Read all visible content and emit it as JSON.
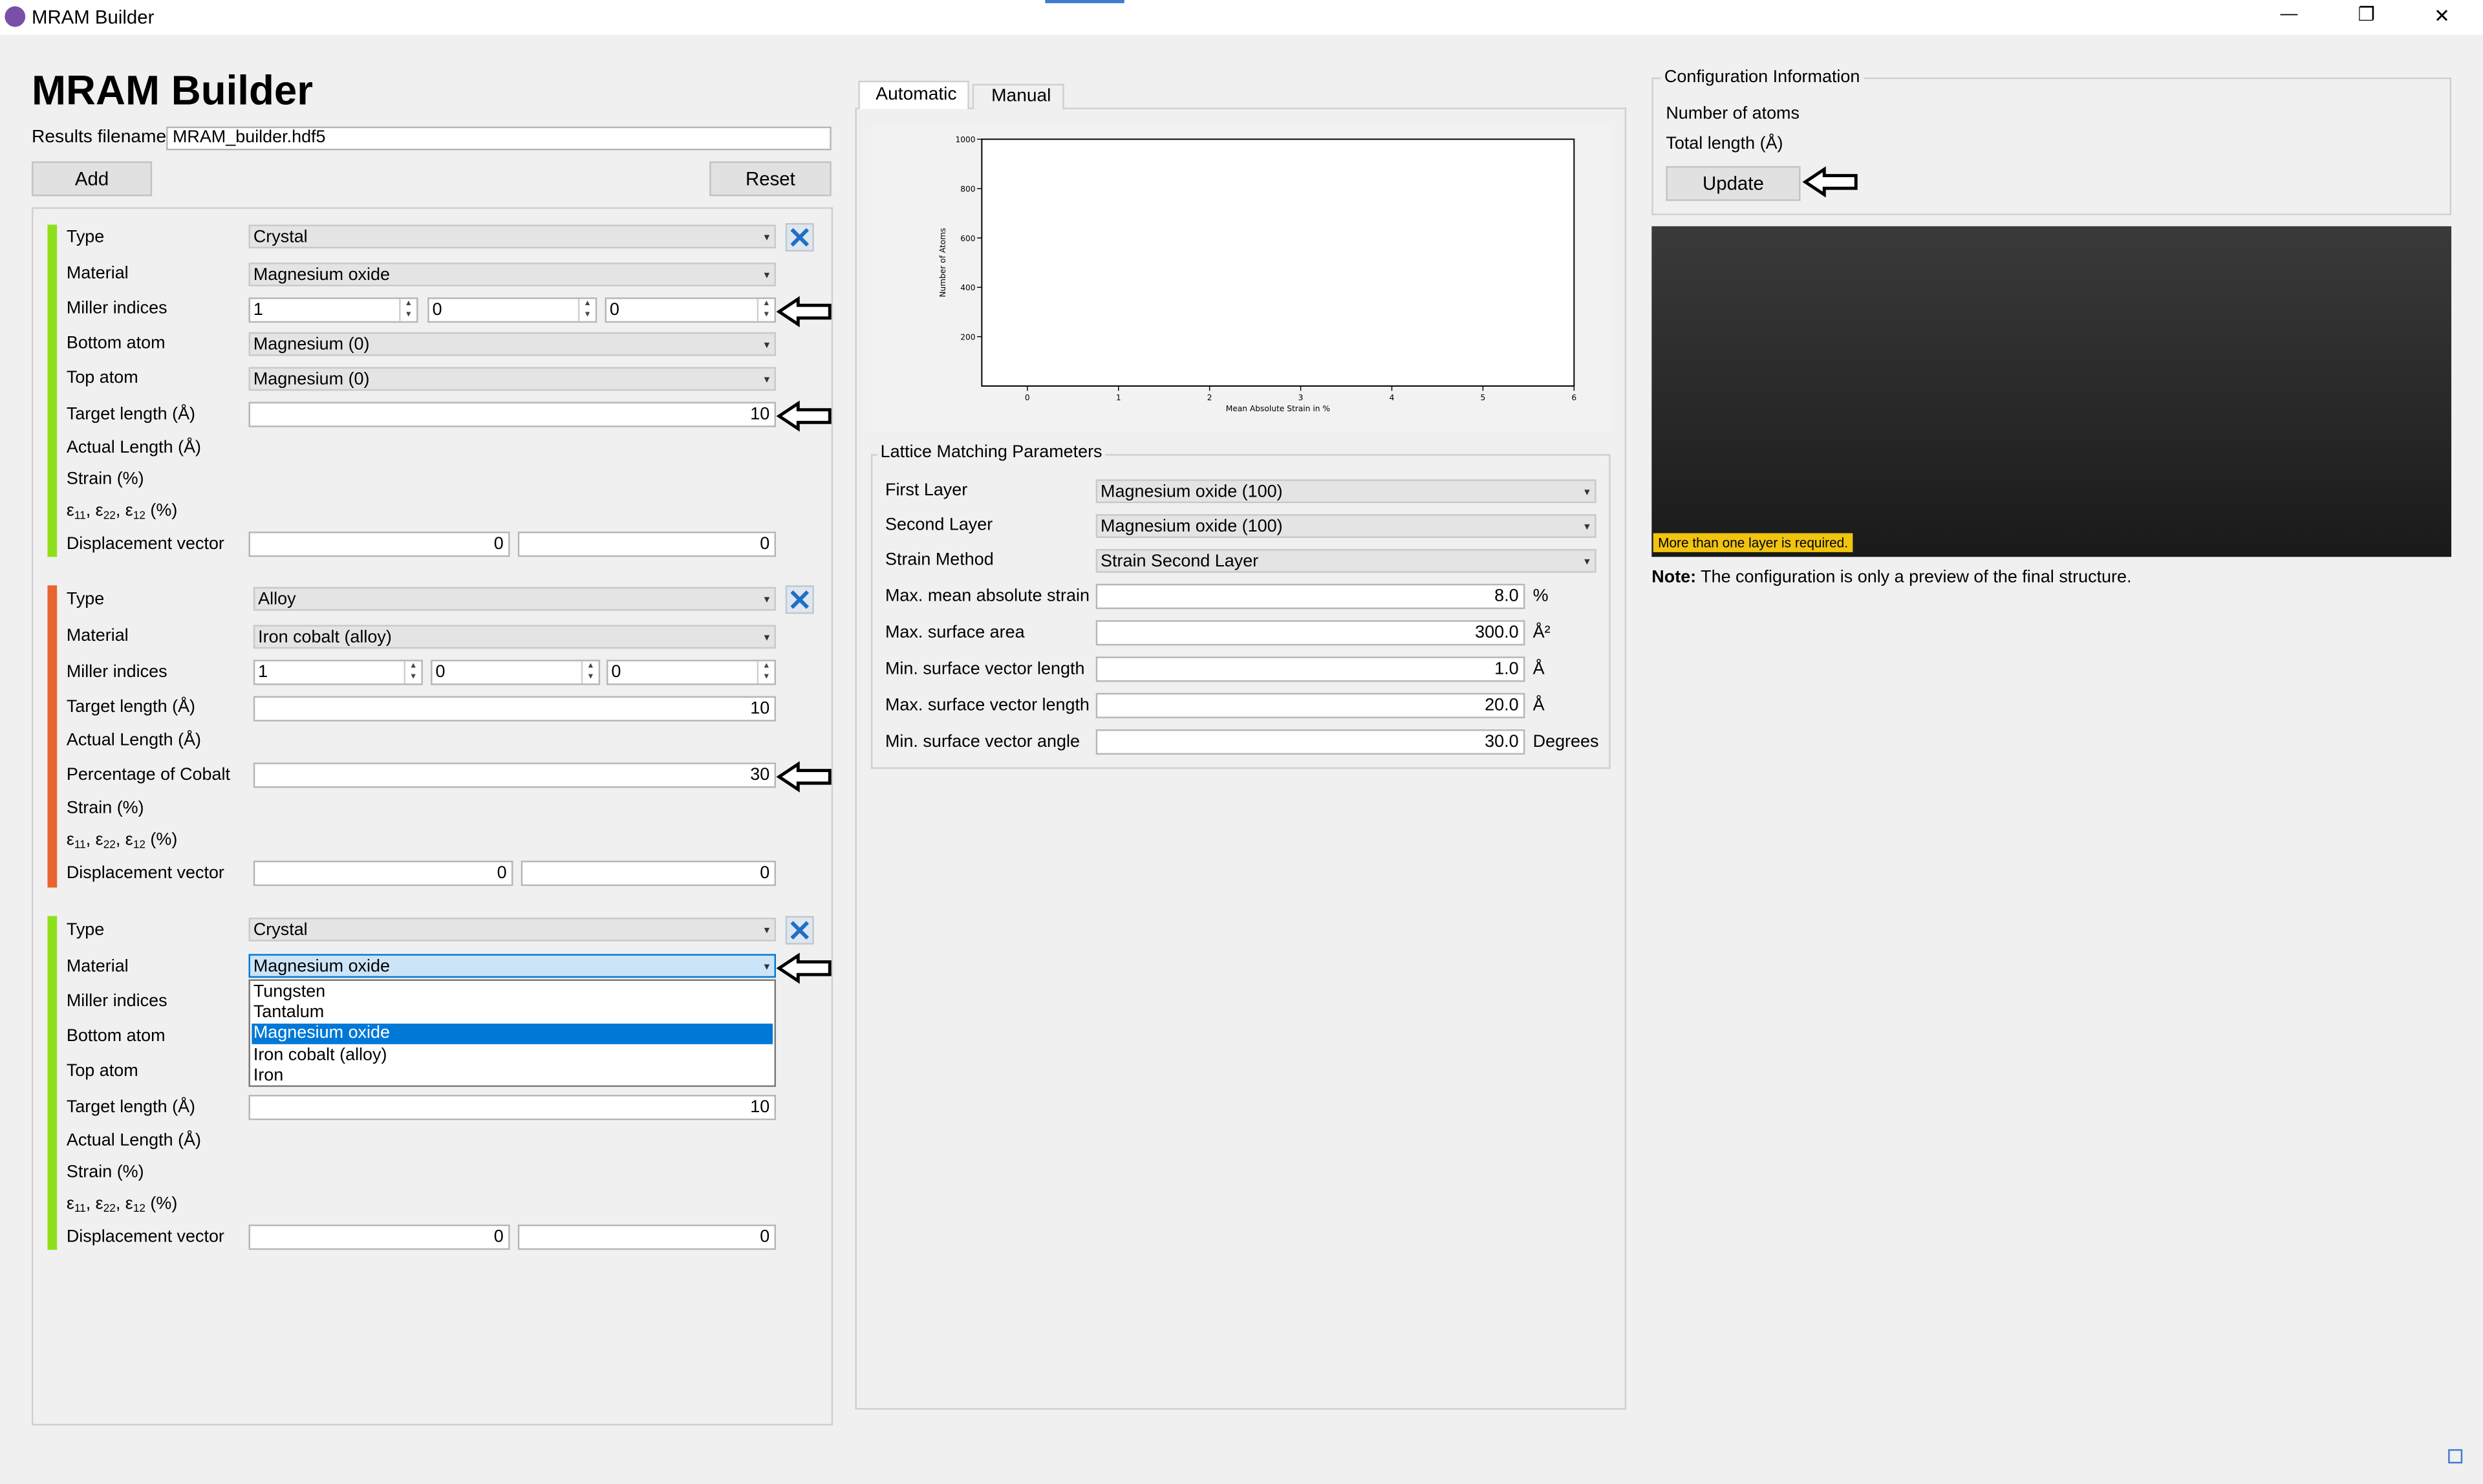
{
  "window": {
    "title": "MRAM Builder",
    "minimize": "—",
    "restore": "❐",
    "close": "✕"
  },
  "header": {
    "title": "MRAM Builder"
  },
  "results": {
    "label": "Results filename",
    "value": "MRAM_builder.hdf5"
  },
  "toolbar": {
    "add_label": "Add",
    "reset_label": "Reset"
  },
  "layers": [
    {
      "color": "#8ee01b",
      "type_label": "Type",
      "type_value": "Crystal",
      "material_label": "Material",
      "material_value": "Magnesium oxide",
      "miller_label": "Miller indices",
      "miller": [
        "1",
        "0",
        "0"
      ],
      "bottom_label": "Bottom atom",
      "bottom_value": "Magnesium (0)",
      "top_label": "Top atom",
      "top_value": "Magnesium (0)",
      "target_label": "Target length (Å)",
      "target_value": "10",
      "actual_label": "Actual Length (Å)",
      "strain_label": "Strain (%)",
      "eps_label": "ε11, ε22, ε12 (%)",
      "disp_label": "Displacement vector",
      "disp": [
        "0",
        "0"
      ]
    },
    {
      "color": "#e8652f",
      "type_label": "Type",
      "type_value": "Alloy",
      "material_label": "Material",
      "material_value": "Iron cobalt (alloy)",
      "miller_label": "Miller indices",
      "miller": [
        "1",
        "0",
        "0"
      ],
      "target_label": "Target length (Å)",
      "target_value": "10",
      "actual_label": "Actual Length (Å)",
      "pct_label": "Percentage of Cobalt",
      "pct_value": "30",
      "strain_label": "Strain (%)",
      "eps_label": "ε11, ε22, ε12 (%)",
      "disp_label": "Displacement vector",
      "disp": [
        "0",
        "0"
      ]
    },
    {
      "color": "#8ee01b",
      "type_label": "Type",
      "type_value": "Crystal",
      "material_label": "Material",
      "material_value": "Magnesium oxide",
      "dropdown": [
        "Tungsten",
        "Tantalum",
        "Magnesium oxide",
        "Iron cobalt (alloy)",
        "Iron"
      ],
      "dropdown_selected": "Magnesium oxide",
      "miller_label": "Miller indices",
      "bottom_label": "Bottom atom",
      "top_label": "Top atom",
      "target_label": "Target length (Å)",
      "target_value": "10",
      "actual_label": "Actual Length (Å)",
      "strain_label": "Strain (%)",
      "eps_label": "ε11, ε22, ε12 (%)",
      "disp_label": "Displacement vector",
      "disp": [
        "0",
        "0"
      ]
    }
  ],
  "tabs": [
    {
      "label": "Automatic",
      "active": true
    },
    {
      "label": "Manual",
      "active": false
    }
  ],
  "chart_data": {
    "type": "scatter",
    "title": "",
    "xlabel": "Mean Absolute Strain in %",
    "ylabel": "Number of Atoms",
    "xlim": [
      -0.5,
      6
    ],
    "ylim": [
      0,
      1000
    ],
    "xticks": [
      "0",
      "1",
      "2",
      "3",
      "4",
      "5",
      "6"
    ],
    "yticks": [
      "200",
      "400",
      "600",
      "800",
      "1000"
    ],
    "series": []
  },
  "lattice": {
    "title": "Lattice Matching Parameters",
    "first_layer_label": "First Layer",
    "first_layer_value": "Magnesium oxide (100)",
    "second_layer_label": "Second Layer",
    "second_layer_value": "Magnesium oxide (100)",
    "strain_method_label": "Strain Method",
    "strain_method_value": "Strain Second Layer",
    "max_strain_label": "Max. mean absolute strain",
    "max_strain_value": "8.0",
    "max_strain_unit": "%",
    "max_area_label": "Max. surface area",
    "max_area_value": "300.0",
    "max_area_unit": "Å²",
    "min_vec_label": "Min. surface vector length",
    "min_vec_value": "1.0",
    "min_vec_unit": "Å",
    "max_vec_label": "Max. surface vector length",
    "max_vec_value": "20.0",
    "max_vec_unit": "Å",
    "min_angle_label": "Min. surface vector angle",
    "min_angle_value": "30.0",
    "min_angle_unit": "Degrees"
  },
  "config": {
    "title": "Configuration Information",
    "atoms_label": "Number of atoms",
    "length_label": "Total length (Å)",
    "update_label": "Update"
  },
  "preview": {
    "warning": "More than one layer is required."
  },
  "note": {
    "bold": "Note:",
    "text": " The configuration is only a preview of the final structure."
  }
}
